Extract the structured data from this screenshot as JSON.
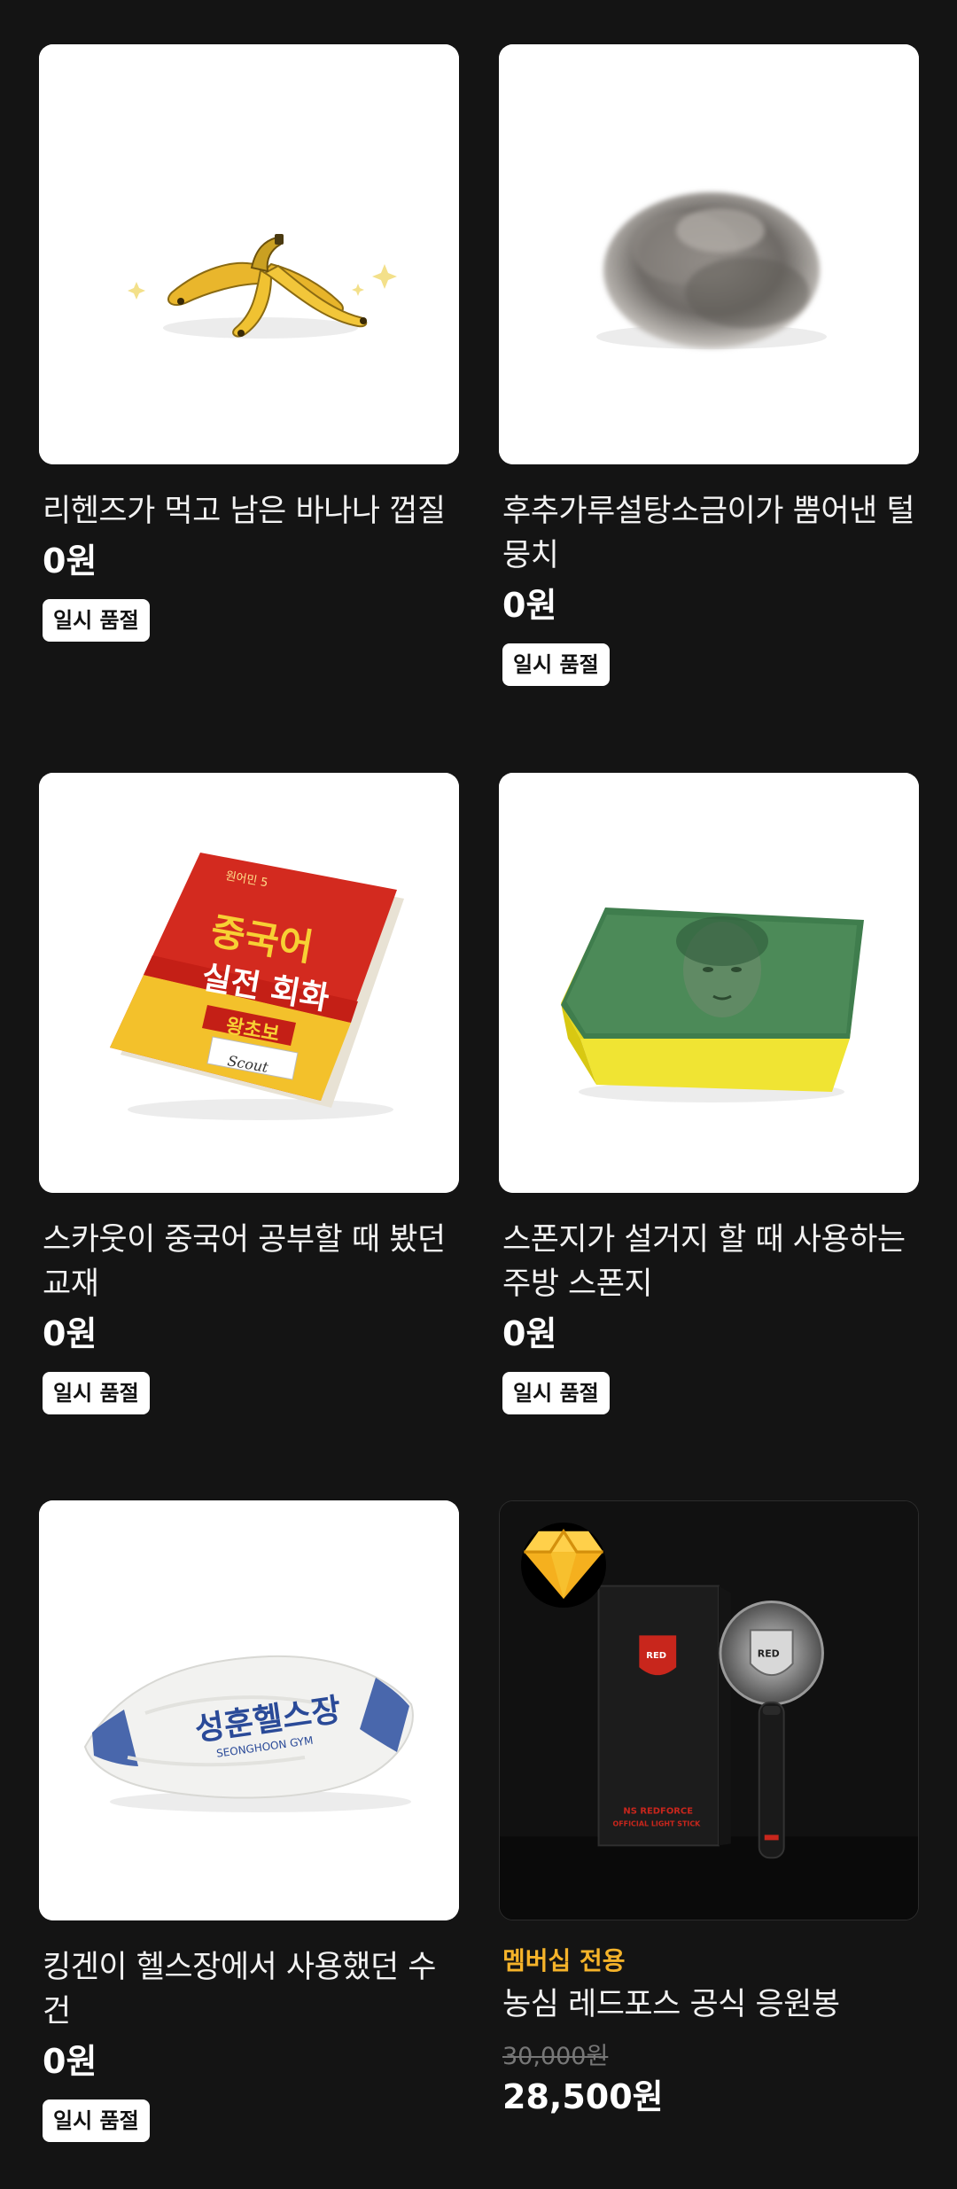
{
  "products": [
    {
      "title": "리헨즈가 먹고 남은 바나나 껍질",
      "price": "0원",
      "badge": "일시 품절"
    },
    {
      "title": "후추가루설탕소금이가 뿜어낸 털 뭉치",
      "price": "0원",
      "badge": "일시 품절"
    },
    {
      "title": "스카웃이 중국어 공부할 때 봤던 교재",
      "price": "0원",
      "badge": "일시 품절",
      "book_text": {
        "line1": "중국어",
        "line2": "실전 회화",
        "ribbon": "왕초보",
        "label": "Scout",
        "top": "원어민 5"
      }
    },
    {
      "title": "스폰지가 설거지 할 때 사용하는 주방 스폰지",
      "price": "0원",
      "badge": "일시 품절"
    },
    {
      "title": "킹겐이 헬스장에서 사용했던 수건",
      "price": "0원",
      "badge": "일시 품절",
      "towel_text": {
        "main": "성훈헬스장",
        "sub": "SEONGHOON GYM"
      }
    },
    {
      "title": "농심 레드포스 공식 응원봉",
      "member_label": "멤버십 전용",
      "original_price": "30,000원",
      "price": "28,500원",
      "box_text": {
        "line1": "NS REDFORCE",
        "line2": "OFFICIAL LIGHT STICK",
        "logo": "RED"
      }
    }
  ],
  "colors": {
    "background": "#141414",
    "member_accent": "#f5b32a",
    "badge_bg": "#ffffff"
  },
  "icons": {
    "membership": "diamond-icon"
  }
}
